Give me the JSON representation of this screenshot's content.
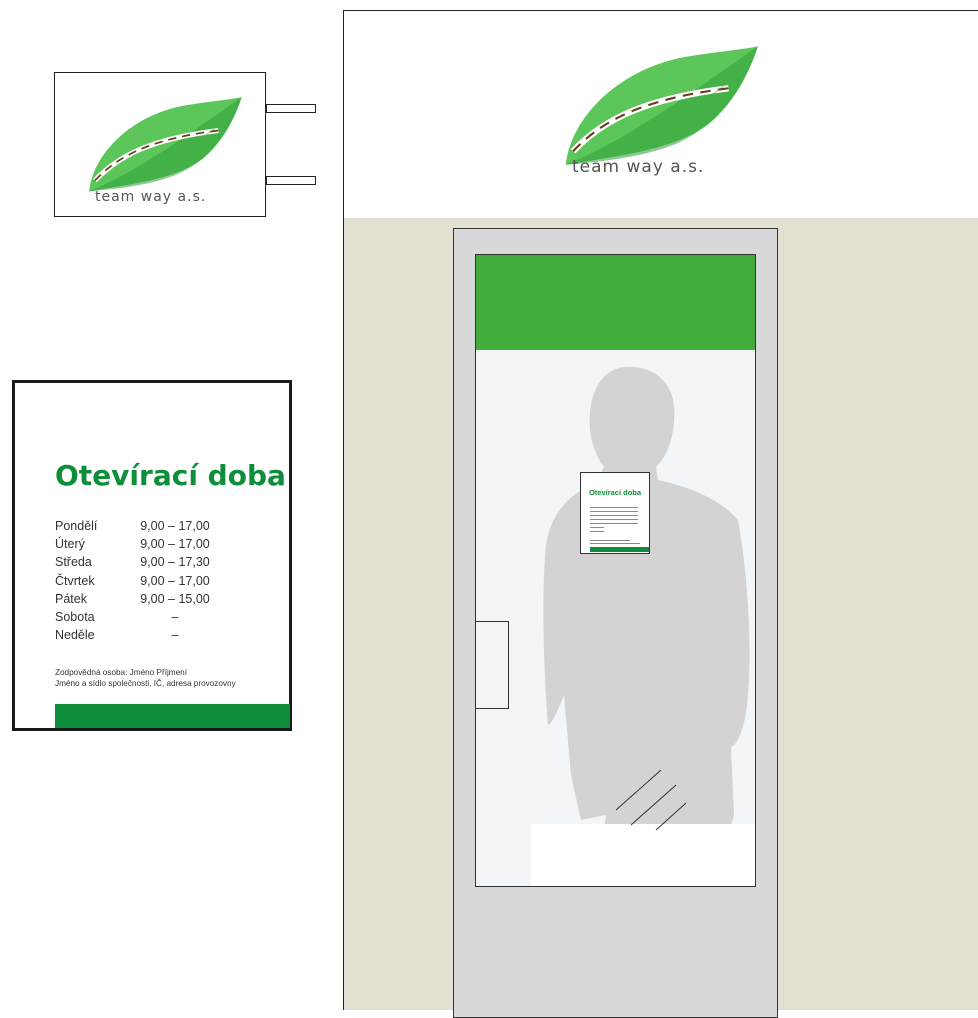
{
  "brand": {
    "name": "team way a.s.",
    "colors": {
      "leaf_light": "#5cc65a",
      "leaf_dark": "#2f9e3a",
      "road_dash": "#6b3a1e",
      "accent_green": "#0e8e3a",
      "banner_green": "#43ad3b",
      "wall": "#e3dfd1",
      "door_frame": "#d8d8d8",
      "silhouette": "#d3d3d3"
    },
    "logo_icon": "leaf-road-icon"
  },
  "hours_sign": {
    "title": "Otevírací doba",
    "rows": [
      {
        "day": "Pondělí",
        "time": "9,00 – 17,00"
      },
      {
        "day": "Úterý",
        "time": "9,00 – 17,00"
      },
      {
        "day": "Středa",
        "time": "9,00 – 17,30"
      },
      {
        "day": "Čtvrtek",
        "time": "9,00 – 17,00"
      },
      {
        "day": "Pátek",
        "time": "9,00 – 15,00"
      },
      {
        "day": "Sobota",
        "time": "–"
      },
      {
        "day": "Neděle",
        "time": "–"
      }
    ],
    "footer_line1": "Zodpovědná osoba: Jméno Příjmení",
    "footer_line2": "Jméno a sídlo společnosti, IČ, adresa provozovny"
  },
  "mini_sign": {
    "title": "Otevírací doba"
  }
}
